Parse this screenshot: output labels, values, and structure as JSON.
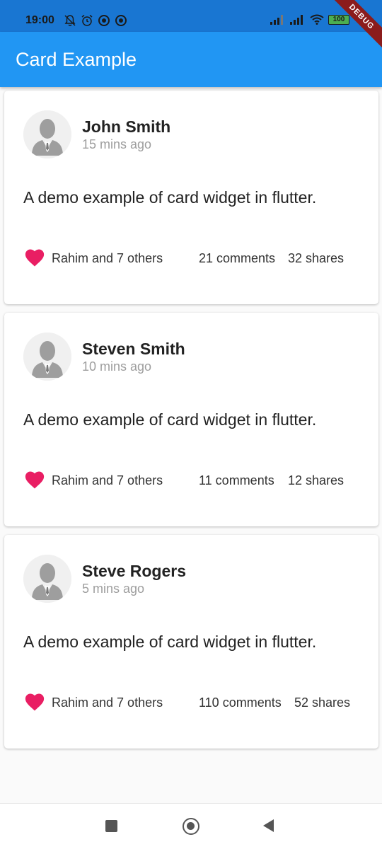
{
  "status_bar": {
    "time": "19:00",
    "battery": "100",
    "left_icons": [
      "bell-off-icon",
      "alarm-icon",
      "data-saver-icon",
      "data-saver-icon"
    ],
    "right_icons": [
      "signal-icon",
      "signal-icon",
      "wifi-icon",
      "battery-icon"
    ]
  },
  "debug_banner": "DEBUG",
  "app_bar": {
    "title": "Card Example",
    "color": "#2196f3"
  },
  "cards": [
    {
      "name": "John Smith",
      "time": "15 mins ago",
      "description": "A demo example of card widget in flutter.",
      "likes": "Rahim and 7 others",
      "comments": "21 comments",
      "shares": "32 shares"
    },
    {
      "name": "Steven Smith",
      "time": "10 mins ago",
      "description": "A demo example of card widget in flutter.",
      "likes": "Rahim and 7 others",
      "comments": "11 comments",
      "shares": "12 shares"
    },
    {
      "name": "Steve Rogers",
      "time": "5 mins ago",
      "description": "A demo example of card widget in flutter.",
      "likes": "Rahim and 7 others",
      "comments": "110 comments",
      "shares": "52 shares"
    }
  ],
  "heart_color": "#e91e63",
  "nav_bar": {
    "icons": [
      "recents-icon",
      "home-icon",
      "back-icon"
    ]
  }
}
